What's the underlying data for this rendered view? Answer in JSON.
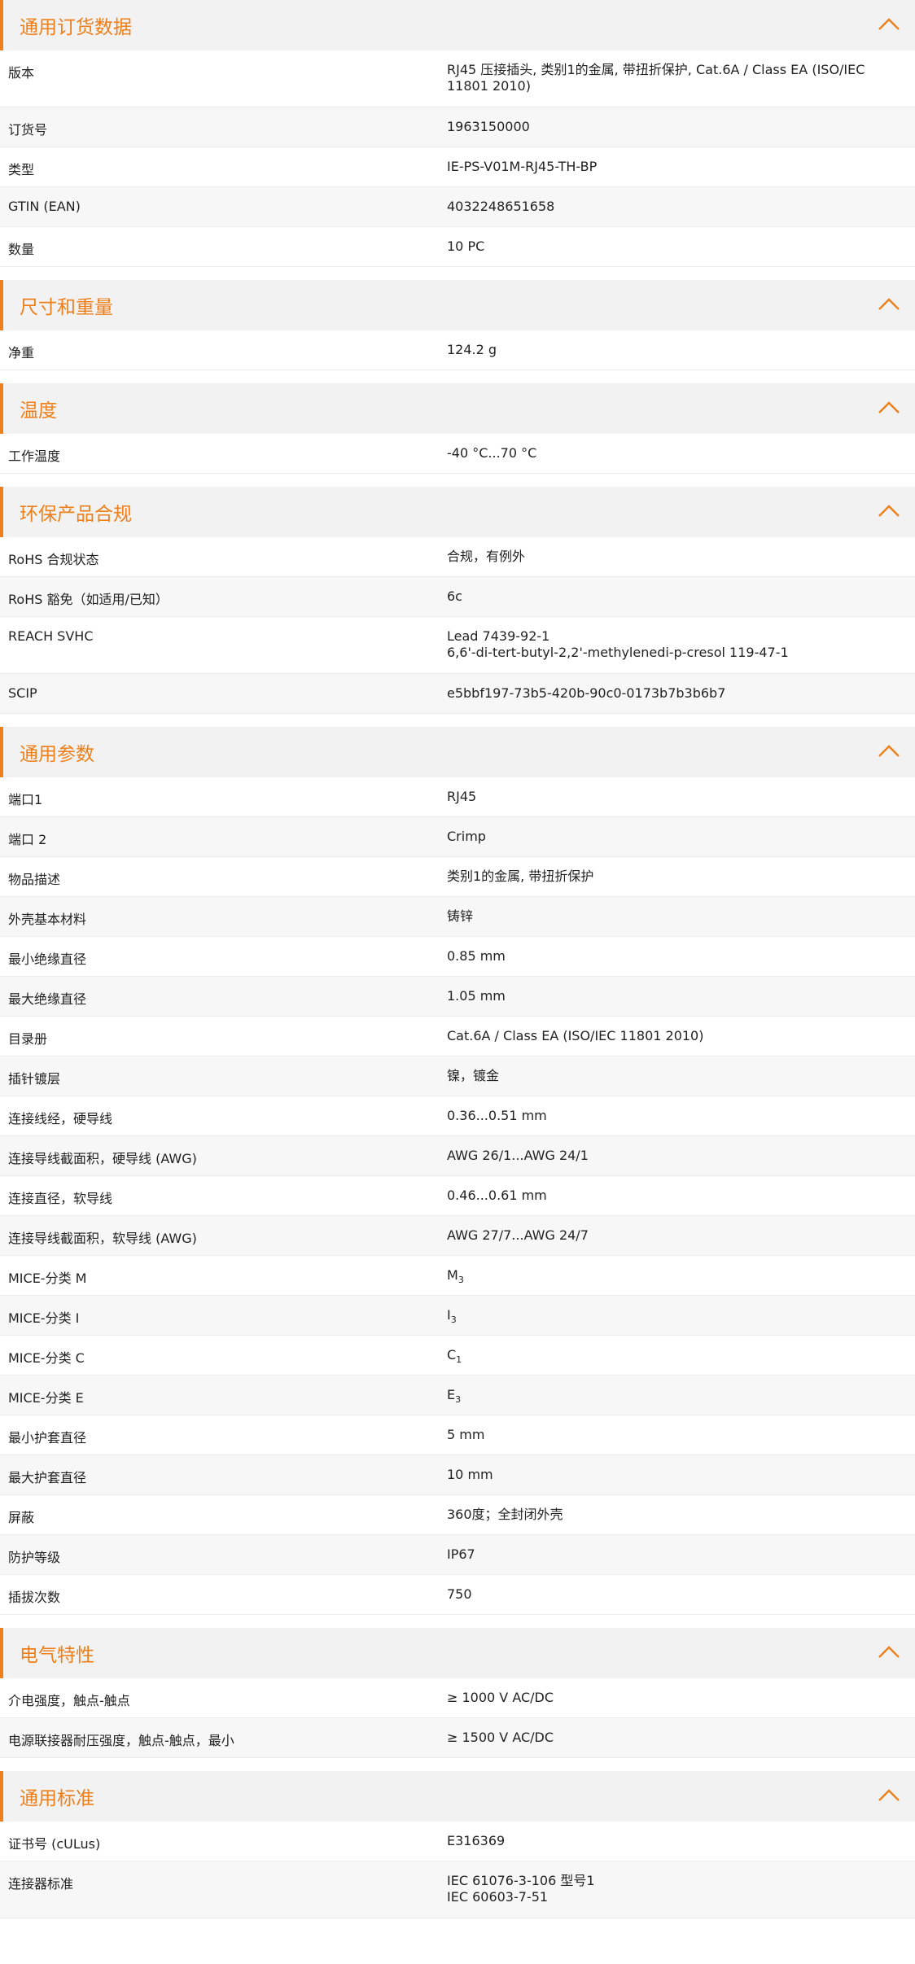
{
  "accent_color": "#ee7f1a",
  "chevron_icon": "chevron-up-icon",
  "sections": [
    {
      "title": "通用订货数据",
      "rows": [
        {
          "label": "版本",
          "value": [
            "RJ45 压接插头, 类别1的金属, 带扭折保护, Cat.6A / Class EA (ISO/IEC",
            "11801 2010)"
          ]
        },
        {
          "label": "订货号",
          "value": [
            "1963150000"
          ]
        },
        {
          "label": "类型",
          "value": [
            "IE-PS-V01M-RJ45-TH-BP"
          ]
        },
        {
          "label": "GTIN (EAN)",
          "value": [
            "4032248651658"
          ]
        },
        {
          "label": "数量",
          "value": [
            "10  PC"
          ]
        }
      ]
    },
    {
      "title": "尺寸和重量",
      "rows": [
        {
          "label": "净重",
          "value": [
            "124.2  g"
          ]
        }
      ]
    },
    {
      "title": "温度",
      "rows": [
        {
          "label": "工作温度",
          "value": [
            "-40 °C...70 °C"
          ]
        }
      ]
    },
    {
      "title": "环保产品合规",
      "rows": [
        {
          "label": "RoHS 合规状态",
          "value": [
            "合规，有例外"
          ]
        },
        {
          "label": "RoHS 豁免（如适用/已知）",
          "value": [
            "6c"
          ]
        },
        {
          "label": "REACH SVHC",
          "value": [
            "Lead 7439-92-1",
            "6,6'-di-tert-butyl-2,2'-methylenedi-p-cresol 119-47-1"
          ]
        },
        {
          "label": "SCIP",
          "value": [
            "e5bbf197-73b5-420b-90c0-0173b7b3b6b7"
          ]
        }
      ]
    },
    {
      "title": "通用参数",
      "rows": [
        {
          "label": "端口1",
          "value": [
            "RJ45"
          ]
        },
        {
          "label": "端口 2",
          "value": [
            "Crimp"
          ]
        },
        {
          "label": "物品描述",
          "value": [
            "类别1的金属, 带扭折保护"
          ]
        },
        {
          "label": "外壳基本材料",
          "value": [
            "铸锌"
          ]
        },
        {
          "label": "最小绝缘直径",
          "value": [
            "0.85  mm"
          ]
        },
        {
          "label": "最大绝缘直径",
          "value": [
            "1.05  mm"
          ]
        },
        {
          "label": "目录册",
          "value": [
            "Cat.6A / Class EA (ISO/IEC 11801 2010)"
          ]
        },
        {
          "label": "插针镀层",
          "value": [
            "镍，镀金"
          ]
        },
        {
          "label": "连接线经，硬导线",
          "value": [
            "0.36...0.51 mm"
          ]
        },
        {
          "label": "连接导线截面积，硬导线 (AWG)",
          "value": [
            "AWG 26/1...AWG 24/1"
          ]
        },
        {
          "label": "连接直径，软导线",
          "value": [
            "0.46...0.61 mm"
          ]
        },
        {
          "label": "连接导线截面积，软导线 (AWG)",
          "value": [
            "AWG 27/7...AWG 24/7"
          ]
        },
        {
          "label": "MICE-分类 M",
          "value": [
            "M"
          ],
          "sub": "3"
        },
        {
          "label": "MICE-分类 I",
          "value": [
            "I"
          ],
          "sub": "3"
        },
        {
          "label": "MICE-分类 C",
          "value": [
            "C"
          ],
          "sub": "1"
        },
        {
          "label": "MICE-分类 E",
          "value": [
            "E"
          ],
          "sub": "3"
        },
        {
          "label": "最小护套直径",
          "value": [
            "5  mm"
          ]
        },
        {
          "label": "最大护套直径",
          "value": [
            "10  mm"
          ]
        },
        {
          "label": "屏蔽",
          "value": [
            "360度；全封闭外壳"
          ]
        },
        {
          "label": "防护等级",
          "value": [
            "IP67"
          ]
        },
        {
          "label": "插拔次数",
          "value": [
            "750"
          ]
        }
      ]
    },
    {
      "title": "电气特性",
      "rows": [
        {
          "label": "介电强度，触点-触点",
          "value": [
            "≥ 1000 V AC/DC"
          ]
        },
        {
          "label": "电源联接器耐压强度，触点-触点，最小",
          "value": [
            "≥ 1500 V AC/DC"
          ]
        }
      ]
    },
    {
      "title": "通用标准",
      "rows": [
        {
          "label": "证书号 (cULus)",
          "value": [
            "E316369"
          ]
        },
        {
          "label": "连接器标准",
          "value": [
            "IEC 61076-3-106 型号1",
            "IEC 60603-7-51"
          ]
        }
      ]
    }
  ]
}
